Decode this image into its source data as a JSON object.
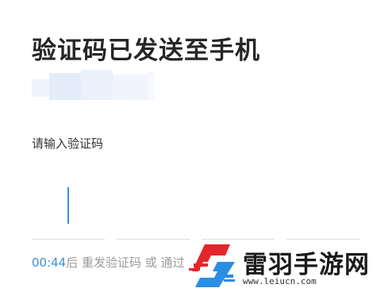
{
  "header": {
    "title": "验证码已发送至手机"
  },
  "form": {
    "code_label": "请输入验证码"
  },
  "code_inputs": {
    "count": 4,
    "active_index": 0,
    "cursor_color": "#3a8ee6"
  },
  "resend": {
    "countdown": "00:44",
    "suffix": "后 重发验证码 或 通过",
    "countdown_color": "#3a8ee6"
  },
  "watermark": {
    "logo_icon": "lightning-s-logo-icon",
    "brand_red": "#e4262a",
    "brand_blue": "#2a8ee4",
    "site_name": "雷羽手游网",
    "url": "www.leiucn.com"
  }
}
